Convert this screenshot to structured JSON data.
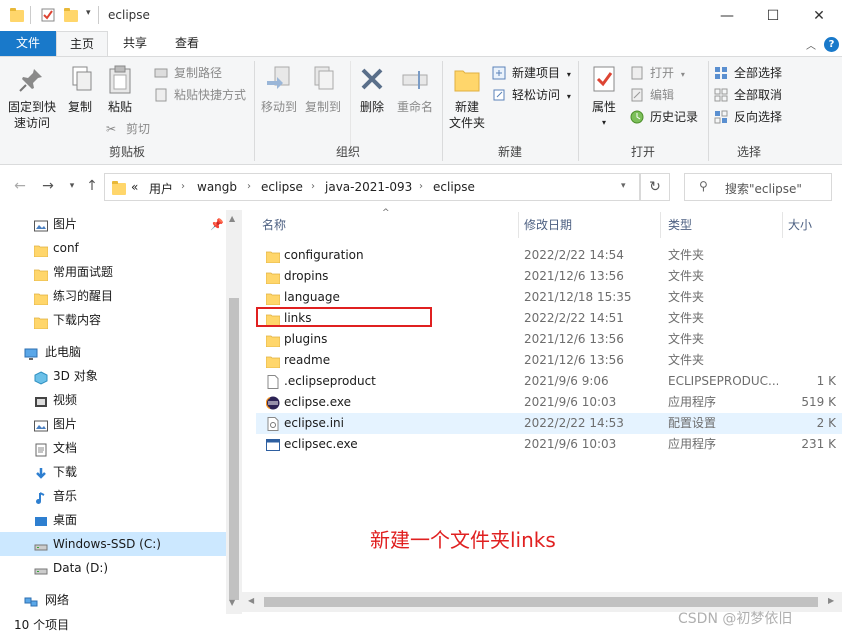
{
  "window": {
    "title": "eclipse",
    "minimize": "—",
    "maximize": "☐",
    "close": "✕"
  },
  "tabs": {
    "file": "文件",
    "home": "主页",
    "share": "共享",
    "view": "查看"
  },
  "ribbon": {
    "clipboard": {
      "label": "剪贴板",
      "pin": "固定到快速访问",
      "pin_line1": "固定到快",
      "pin_line2": "速访问",
      "copy": "复制",
      "paste": "粘贴",
      "copy_path": "复制路径",
      "paste_shortcut": "粘贴快捷方式",
      "cut": "剪切"
    },
    "organize": {
      "label": "组织",
      "move_to": "移动到",
      "copy_to": "复制到",
      "delete": "删除",
      "rename": "重命名"
    },
    "new": {
      "label": "新建",
      "new_folder_line1": "新建",
      "new_folder_line2": "文件夹",
      "new_item": "新建项目",
      "easy_access": "轻松访问"
    },
    "open": {
      "label": "打开",
      "properties": "属性",
      "open": "打开",
      "edit": "编辑",
      "history": "历史记录"
    },
    "select": {
      "label": "选择",
      "select_all": "全部选择",
      "select_none": "全部取消",
      "invert": "反向选择"
    }
  },
  "address": {
    "overflow": "«",
    "crumbs": [
      "用户",
      "wangb",
      "eclipse",
      "java-2021-093",
      "eclipse"
    ]
  },
  "search": {
    "placeholder": "搜索\"eclipse\""
  },
  "nav": {
    "items": [
      {
        "label": "图片",
        "icon": "pictures-icon"
      },
      {
        "label": "conf",
        "icon": "folder-icon"
      },
      {
        "label": "常用面试题",
        "icon": "folder-icon"
      },
      {
        "label": "练习的醒目",
        "icon": "folder-icon"
      },
      {
        "label": "下载内容",
        "icon": "folder-icon"
      },
      {
        "label": "此电脑",
        "icon": "computer-icon"
      },
      {
        "label": "3D 对象",
        "icon": "3d-objects-icon"
      },
      {
        "label": "视频",
        "icon": "videos-icon"
      },
      {
        "label": "图片",
        "icon": "pictures-icon"
      },
      {
        "label": "文档",
        "icon": "documents-icon"
      },
      {
        "label": "下载",
        "icon": "downloads-icon"
      },
      {
        "label": "音乐",
        "icon": "music-icon"
      },
      {
        "label": "桌面",
        "icon": "desktop-icon"
      },
      {
        "label": "Windows-SSD (C:)",
        "icon": "drive-icon"
      },
      {
        "label": "Data (D:)",
        "icon": "drive-icon"
      },
      {
        "label": "网络",
        "icon": "network-icon"
      }
    ]
  },
  "columns": {
    "name": "名称",
    "date": "修改日期",
    "type": "类型",
    "size": "大小"
  },
  "files": [
    {
      "name": "configuration",
      "date": "2022/2/22 14:54",
      "type": "文件夹",
      "size": "",
      "icon": "folder-icon"
    },
    {
      "name": "dropins",
      "date": "2021/12/6 13:56",
      "type": "文件夹",
      "size": "",
      "icon": "folder-icon"
    },
    {
      "name": "language",
      "date": "2021/12/18 15:35",
      "type": "文件夹",
      "size": "",
      "icon": "folder-icon"
    },
    {
      "name": "links",
      "date": "2022/2/22 14:51",
      "type": "文件夹",
      "size": "",
      "icon": "folder-icon"
    },
    {
      "name": "plugins",
      "date": "2021/12/6 13:56",
      "type": "文件夹",
      "size": "",
      "icon": "folder-icon"
    },
    {
      "name": "readme",
      "date": "2021/12/6 13:56",
      "type": "文件夹",
      "size": "",
      "icon": "folder-icon"
    },
    {
      "name": ".eclipseproduct",
      "date": "2021/9/6 9:06",
      "type": "ECLIPSEPRODUC...",
      "size": "1 K",
      "icon": "file-icon"
    },
    {
      "name": "eclipse.exe",
      "date": "2021/9/6 10:03",
      "type": "应用程序",
      "size": "519 K",
      "icon": "eclipse-icon"
    },
    {
      "name": "eclipse.ini",
      "date": "2022/2/22 14:53",
      "type": "配置设置",
      "size": "2 K",
      "icon": "settings-file-icon"
    },
    {
      "name": "eclipsec.exe",
      "date": "2021/9/6 10:03",
      "type": "应用程序",
      "size": "231 K",
      "icon": "console-app-icon"
    }
  ],
  "status": {
    "count": "10 个项目"
  },
  "annotation": {
    "text": "新建一个文件夹links"
  },
  "watermark": "CSDN @初梦依旧",
  "colors": {
    "accent": "#1979ca",
    "annotation": "#e02020",
    "folder": "#ffd66b",
    "selection": "#cce8ff"
  }
}
